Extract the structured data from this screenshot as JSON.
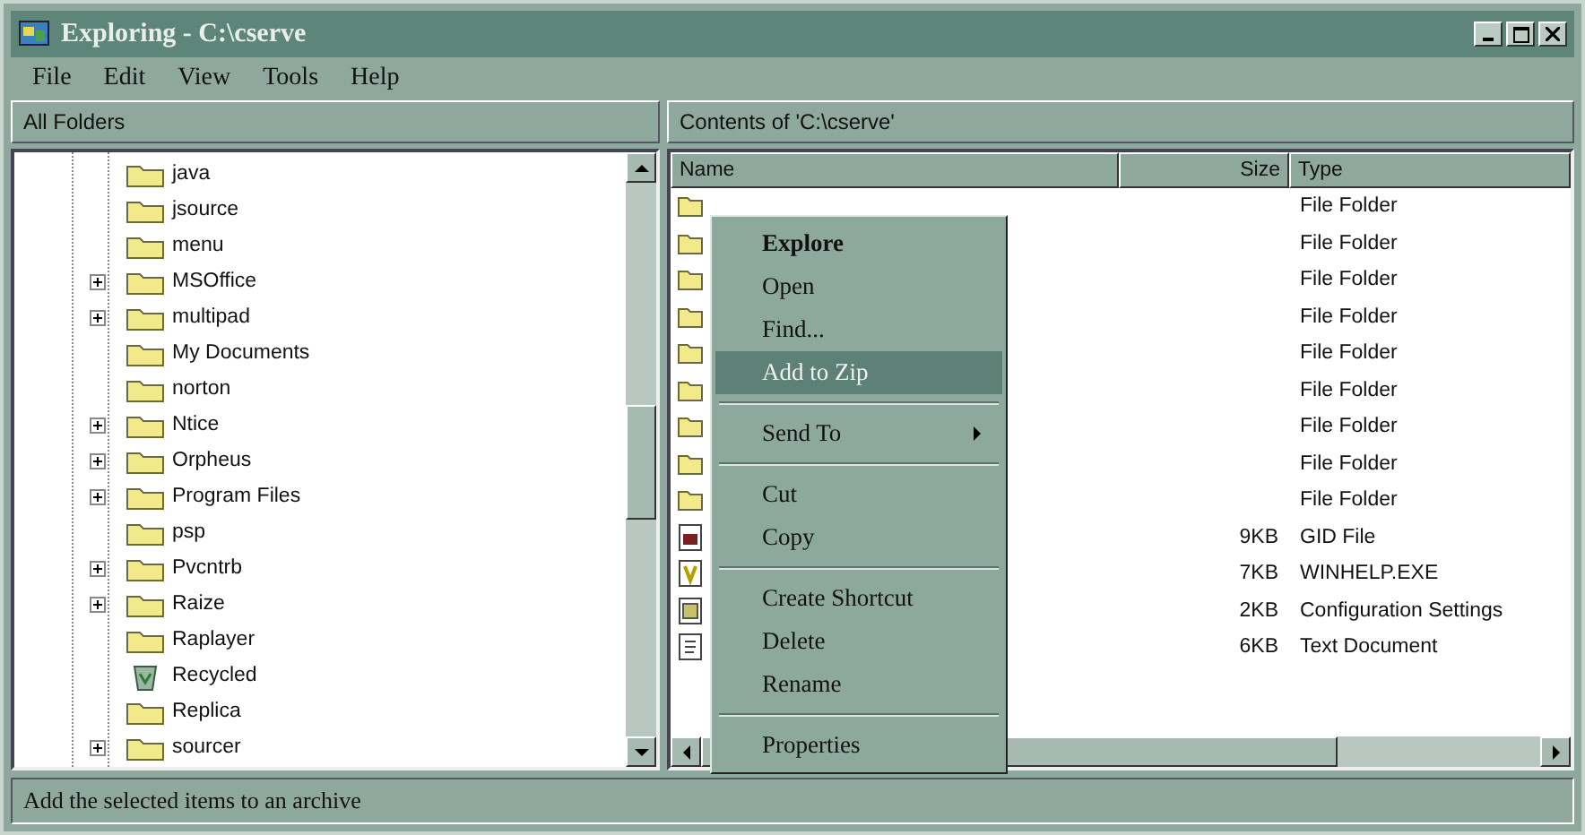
{
  "window": {
    "title": "Exploring - C:\\cserve"
  },
  "menu_bar": [
    "File",
    "Edit",
    "View",
    "Tools",
    "Help"
  ],
  "folders_pane": {
    "header": "All Folders",
    "items": [
      {
        "name": "java",
        "kind": "folder",
        "has_children": false
      },
      {
        "name": "jsource",
        "kind": "folder",
        "has_children": false
      },
      {
        "name": "menu",
        "kind": "folder",
        "has_children": false
      },
      {
        "name": "MSOffice",
        "kind": "folder",
        "has_children": true
      },
      {
        "name": "multipad",
        "kind": "folder",
        "has_children": true
      },
      {
        "name": "My Documents",
        "kind": "folder",
        "has_children": false
      },
      {
        "name": "norton",
        "kind": "folder",
        "has_children": false
      },
      {
        "name": "Ntice",
        "kind": "folder",
        "has_children": true
      },
      {
        "name": "Orpheus",
        "kind": "folder",
        "has_children": true
      },
      {
        "name": "Program Files",
        "kind": "folder",
        "has_children": true
      },
      {
        "name": "psp",
        "kind": "folder",
        "has_children": false
      },
      {
        "name": "Pvcntrb",
        "kind": "folder",
        "has_children": true
      },
      {
        "name": "Raize",
        "kind": "folder",
        "has_children": true
      },
      {
        "name": "Raplayer",
        "kind": "folder",
        "has_children": false
      },
      {
        "name": "Recycled",
        "kind": "recycle",
        "has_children": false
      },
      {
        "name": "Replica",
        "kind": "folder",
        "has_children": false
      },
      {
        "name": "sourcer",
        "kind": "folder",
        "has_children": true
      }
    ]
  },
  "contents_pane": {
    "header": "Contents of 'C:\\cserve'",
    "columns": [
      "Name",
      "Size",
      "Type"
    ],
    "rows": [
      {
        "kind": "folder",
        "type": "File Folder"
      },
      {
        "kind": "folder",
        "type": "File Folder"
      },
      {
        "kind": "folder",
        "type": "File Folder"
      },
      {
        "kind": "folder",
        "type": "File Folder"
      },
      {
        "kind": "folder",
        "type": "File Folder"
      },
      {
        "kind": "folder",
        "type": "File Folder"
      },
      {
        "kind": "folder",
        "type": "File Folder"
      },
      {
        "kind": "folder",
        "type": "File Folder"
      },
      {
        "kind": "folder",
        "type": "File Folder"
      },
      {
        "kind": "gid",
        "size": "9KB",
        "type": "GID File"
      },
      {
        "kind": "exe",
        "size": "7KB",
        "type": "WINHELP.EXE"
      },
      {
        "kind": "ini",
        "size": "2KB",
        "type": "Configuration Settings"
      },
      {
        "kind": "txt",
        "size": "6KB",
        "type": "Text Document"
      }
    ]
  },
  "context_menu": [
    {
      "kind": "item",
      "label": "Explore",
      "default": true,
      "selected": false
    },
    {
      "kind": "item",
      "label": "Open",
      "default": false,
      "selected": false
    },
    {
      "kind": "item",
      "label": "Find...",
      "default": false,
      "selected": false
    },
    {
      "kind": "item",
      "label": "Add to Zip",
      "default": false,
      "selected": true
    },
    {
      "kind": "separator"
    },
    {
      "kind": "submenu",
      "label": "Send To",
      "default": false,
      "selected": false
    },
    {
      "kind": "separator"
    },
    {
      "kind": "item",
      "label": "Cut",
      "default": false,
      "selected": false
    },
    {
      "kind": "item",
      "label": "Copy",
      "default": false,
      "selected": false
    },
    {
      "kind": "separator"
    },
    {
      "kind": "item",
      "label": "Create Shortcut",
      "default": false,
      "selected": false
    },
    {
      "kind": "item",
      "label": "Delete",
      "default": false,
      "selected": false
    },
    {
      "kind": "item",
      "label": "Rename",
      "default": false,
      "selected": false
    },
    {
      "kind": "separator"
    },
    {
      "kind": "item",
      "label": "Properties",
      "default": false,
      "selected": false
    }
  ],
  "status_bar": "Add the selected items to an archive"
}
